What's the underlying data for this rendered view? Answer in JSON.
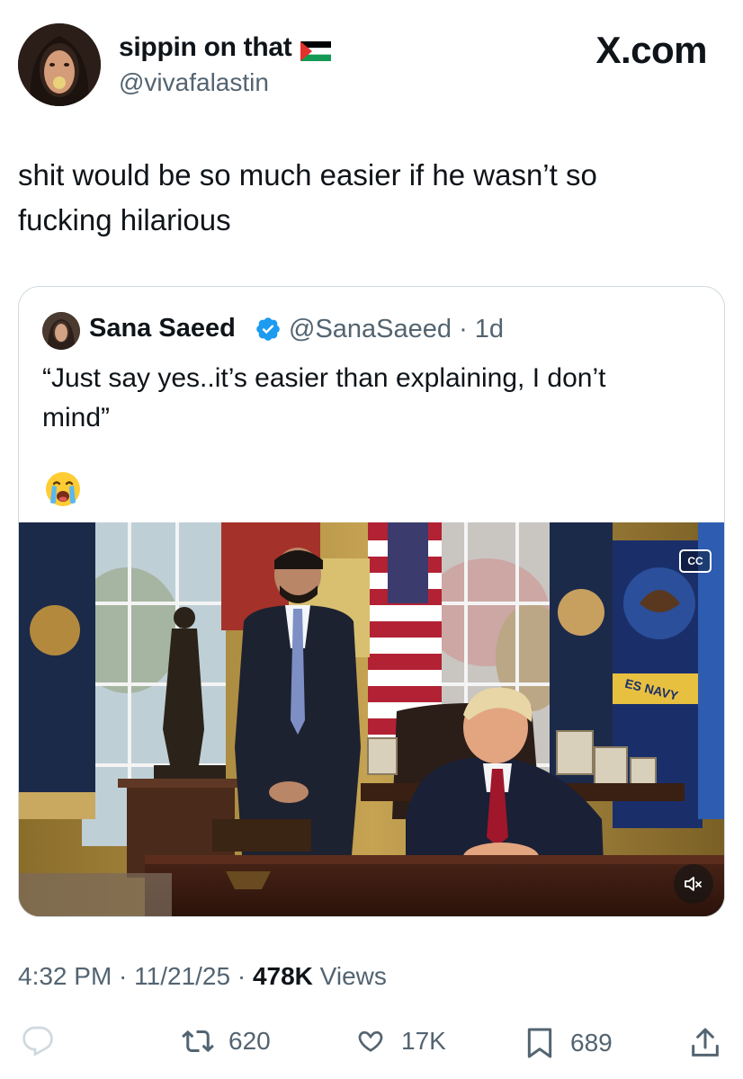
{
  "author": {
    "display_name": "sippin on that",
    "handle": "@vivafalastin",
    "flag_icon": "palestine-flag-icon"
  },
  "site_logo": "X.com",
  "tweet": {
    "text_line1": "shit would be so much easier if he wasn’t so",
    "text_line2": "fucking hilarious"
  },
  "quoted": {
    "display_name": "Sana Saeed",
    "handle": "@SanaSaeed · 1d",
    "text_line1": "“Just say yes..it’s easier than explaining, I don’t",
    "text_line2": "mind”",
    "emoji_icon": "loudly-crying-face-icon",
    "media": {
      "cc_label": "CC",
      "caption_watermark": "ES NAVY"
    }
  },
  "meta": {
    "time_date": "4:32 PM · 11/21/25 · ",
    "views_count": "478K",
    "views_label": " Views"
  },
  "actions": {
    "reposts": "620",
    "likes": "17K",
    "bookmarks": "689"
  },
  "colors": {
    "text": "#0f1419",
    "secondary": "#536471",
    "verified": "#1d9bf0",
    "border": "#cfd9de"
  }
}
